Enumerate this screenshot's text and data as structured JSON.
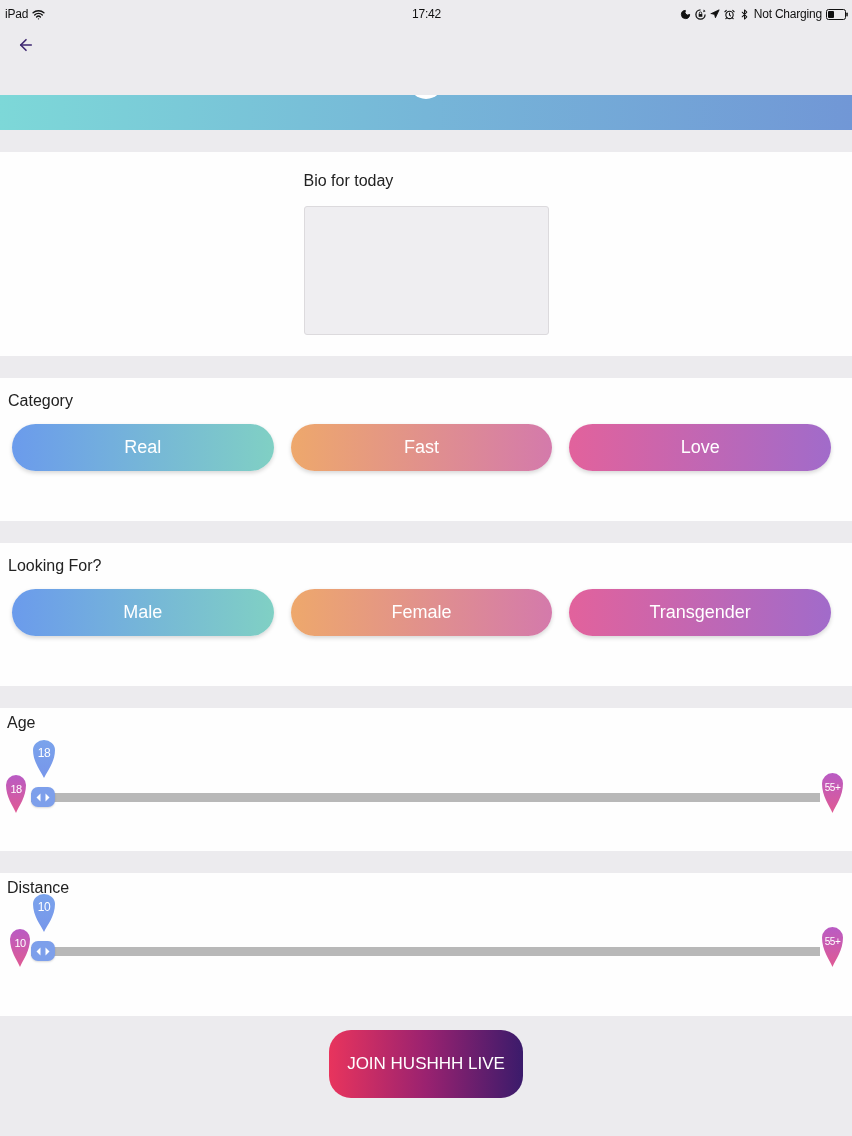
{
  "status_bar": {
    "device": "iPad",
    "time": "17:42",
    "charging_status": "Not Charging"
  },
  "bio": {
    "label": "Bio for today"
  },
  "category": {
    "label": "Category",
    "options": [
      {
        "label": "Real"
      },
      {
        "label": "Fast"
      },
      {
        "label": "Love"
      }
    ]
  },
  "looking_for": {
    "label": "Looking For?",
    "options": [
      {
        "label": "Male"
      },
      {
        "label": "Female"
      },
      {
        "label": "Transgender"
      }
    ]
  },
  "age": {
    "label": "Age",
    "value": "18",
    "min": "18",
    "max": "55+",
    "level": 0
  },
  "distance": {
    "label": "Distance",
    "value": "10",
    "min": "10",
    "max": "55+",
    "level": 0
  },
  "join_button": {
    "label": "JOIN HUSHHH LIVE"
  }
}
